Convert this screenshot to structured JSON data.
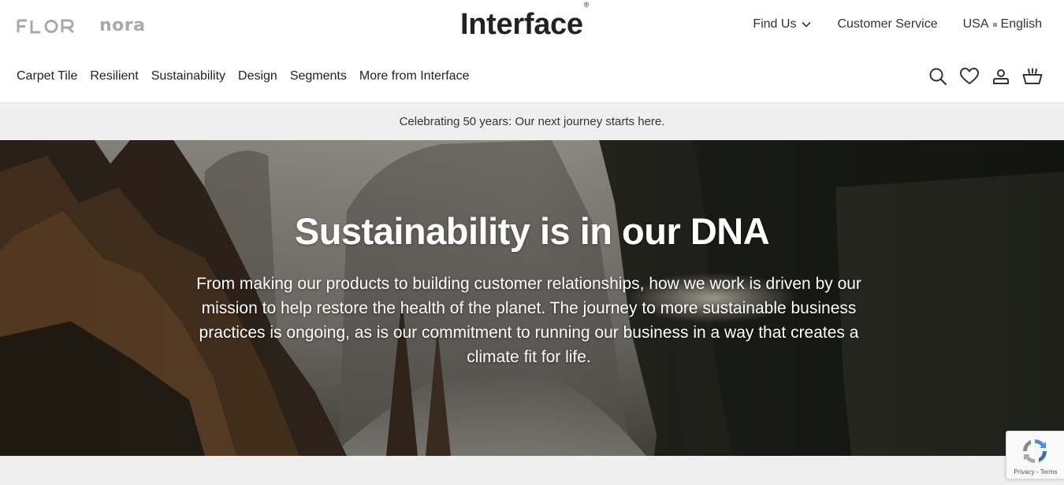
{
  "brands": {
    "flor": "FLOR",
    "nora": "nora",
    "main_logo": "Interface",
    "logo_mark": "®"
  },
  "utility_nav": {
    "find_us": "Find Us",
    "customer_service": "Customer Service",
    "country": "USA",
    "language": "English"
  },
  "main_nav": {
    "items": [
      "Carpet Tile",
      "Resilient",
      "Sustainability",
      "Design",
      "Segments",
      "More from Interface"
    ]
  },
  "icons": {
    "search": "search-icon",
    "wishlist": "heart-icon",
    "account": "user-icon",
    "cart": "basket-icon"
  },
  "announcement": "Celebrating 50 years: Our next journey starts here.",
  "hero": {
    "title": "Sustainability is in our DNA",
    "body": "From making our products to building customer relationships, how we work is driven by our mission to help restore the health of the planet. The journey to more sustainable business practices is ongoing, as is our commitment to running our business in a way that creates a climate fit for life."
  },
  "recaptcha": {
    "privacy": "Privacy",
    "separator": " - ",
    "terms": "Terms"
  },
  "colors": {
    "text": "#222222",
    "muted_brand": "#a9a9a9",
    "announcement_bg": "#efeff0",
    "hero_overlay": "#2f2c27"
  }
}
